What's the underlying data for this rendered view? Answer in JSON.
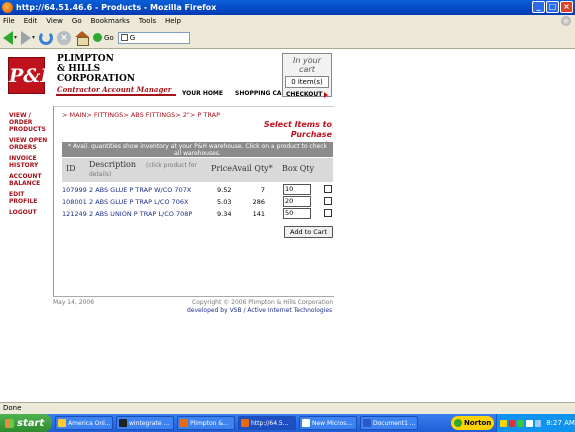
{
  "window": {
    "title": "http://64.51.46.6 - Products - Mozilla Firefox",
    "buttons": [
      "minimize",
      "maximize",
      "close"
    ]
  },
  "menubar": {
    "items": [
      "File",
      "Edit",
      "View",
      "Go",
      "Bookmarks",
      "Tools",
      "Help"
    ]
  },
  "toolbar": {
    "go_label": "Go",
    "url_value": "G"
  },
  "site": {
    "logo_text": "P&H",
    "company_line1": "PLIMPTON",
    "company_line2": "& HILLS",
    "company_line3": "CORPORATION",
    "tagline": "Contractor Account Manager",
    "topnav": [
      "YOUR HOME",
      "SHOPPING CART",
      "CHECKOUT"
    ],
    "cart_label_1": "In your",
    "cart_label_2": "cart",
    "cart_count": "0 item(s)"
  },
  "sidenav": {
    "items": [
      "VIEW / ORDER PRODUCTS",
      "VIEW OPEN ORDERS",
      "INVOICE HISTORY",
      "ACCOUNT BALANCE",
      "EDIT PROFILE",
      "LOGOUT"
    ]
  },
  "breadcrumb": {
    "prefix": "> ",
    "parts": [
      "MAIN",
      "FITTINGS",
      "ABS FITTINGS",
      "2\"",
      "P TRAP"
    ],
    "sep": "> "
  },
  "select_header": {
    "line1": "Select Items to",
    "line2": "Purchase"
  },
  "avail_note": "* Avail. quantities show inventory at your P&H warehouse. Click on a product to check all warehouses.",
  "table": {
    "headers": {
      "id": "ID",
      "description": "Description",
      "description_sub_1": "(click product for",
      "description_sub_2": "details)",
      "price": "Price",
      "avail": "Avail Qty*",
      "box": "Box Qty"
    },
    "rows": [
      {
        "id": "107999",
        "description": "2 ABS GLUE P TRAP W/CO 707X",
        "price": "9.52",
        "avail": "7",
        "box_qty": "10",
        "checked": false
      },
      {
        "id": "108001",
        "description": "2 ABS GLUE P TRAP L/CO 706X",
        "price": "5.03",
        "avail": "286",
        "box_qty": "20",
        "checked": false
      },
      {
        "id": "121249",
        "description": "2 ABS UNION P TRAP L/CO 708P",
        "price": "9.34",
        "avail": "141",
        "box_qty": "50",
        "checked": false
      }
    ]
  },
  "add_to_cart_label": "Add to Cart",
  "footer": {
    "date": "May 14, 2006",
    "copyright": "Copyright © 2006 Plimpton & Hills Corporation",
    "developer": "developed by VSB / Active Internet Technologies"
  },
  "status": "Done",
  "taskbar": {
    "start": "start",
    "items": [
      "America Onl...",
      "wIntegrate ...",
      "Plimpton &...",
      "http://64.5...",
      "New Micros...",
      "Document1 ..."
    ],
    "norton": "Norton",
    "clock": "8:27 AM"
  }
}
